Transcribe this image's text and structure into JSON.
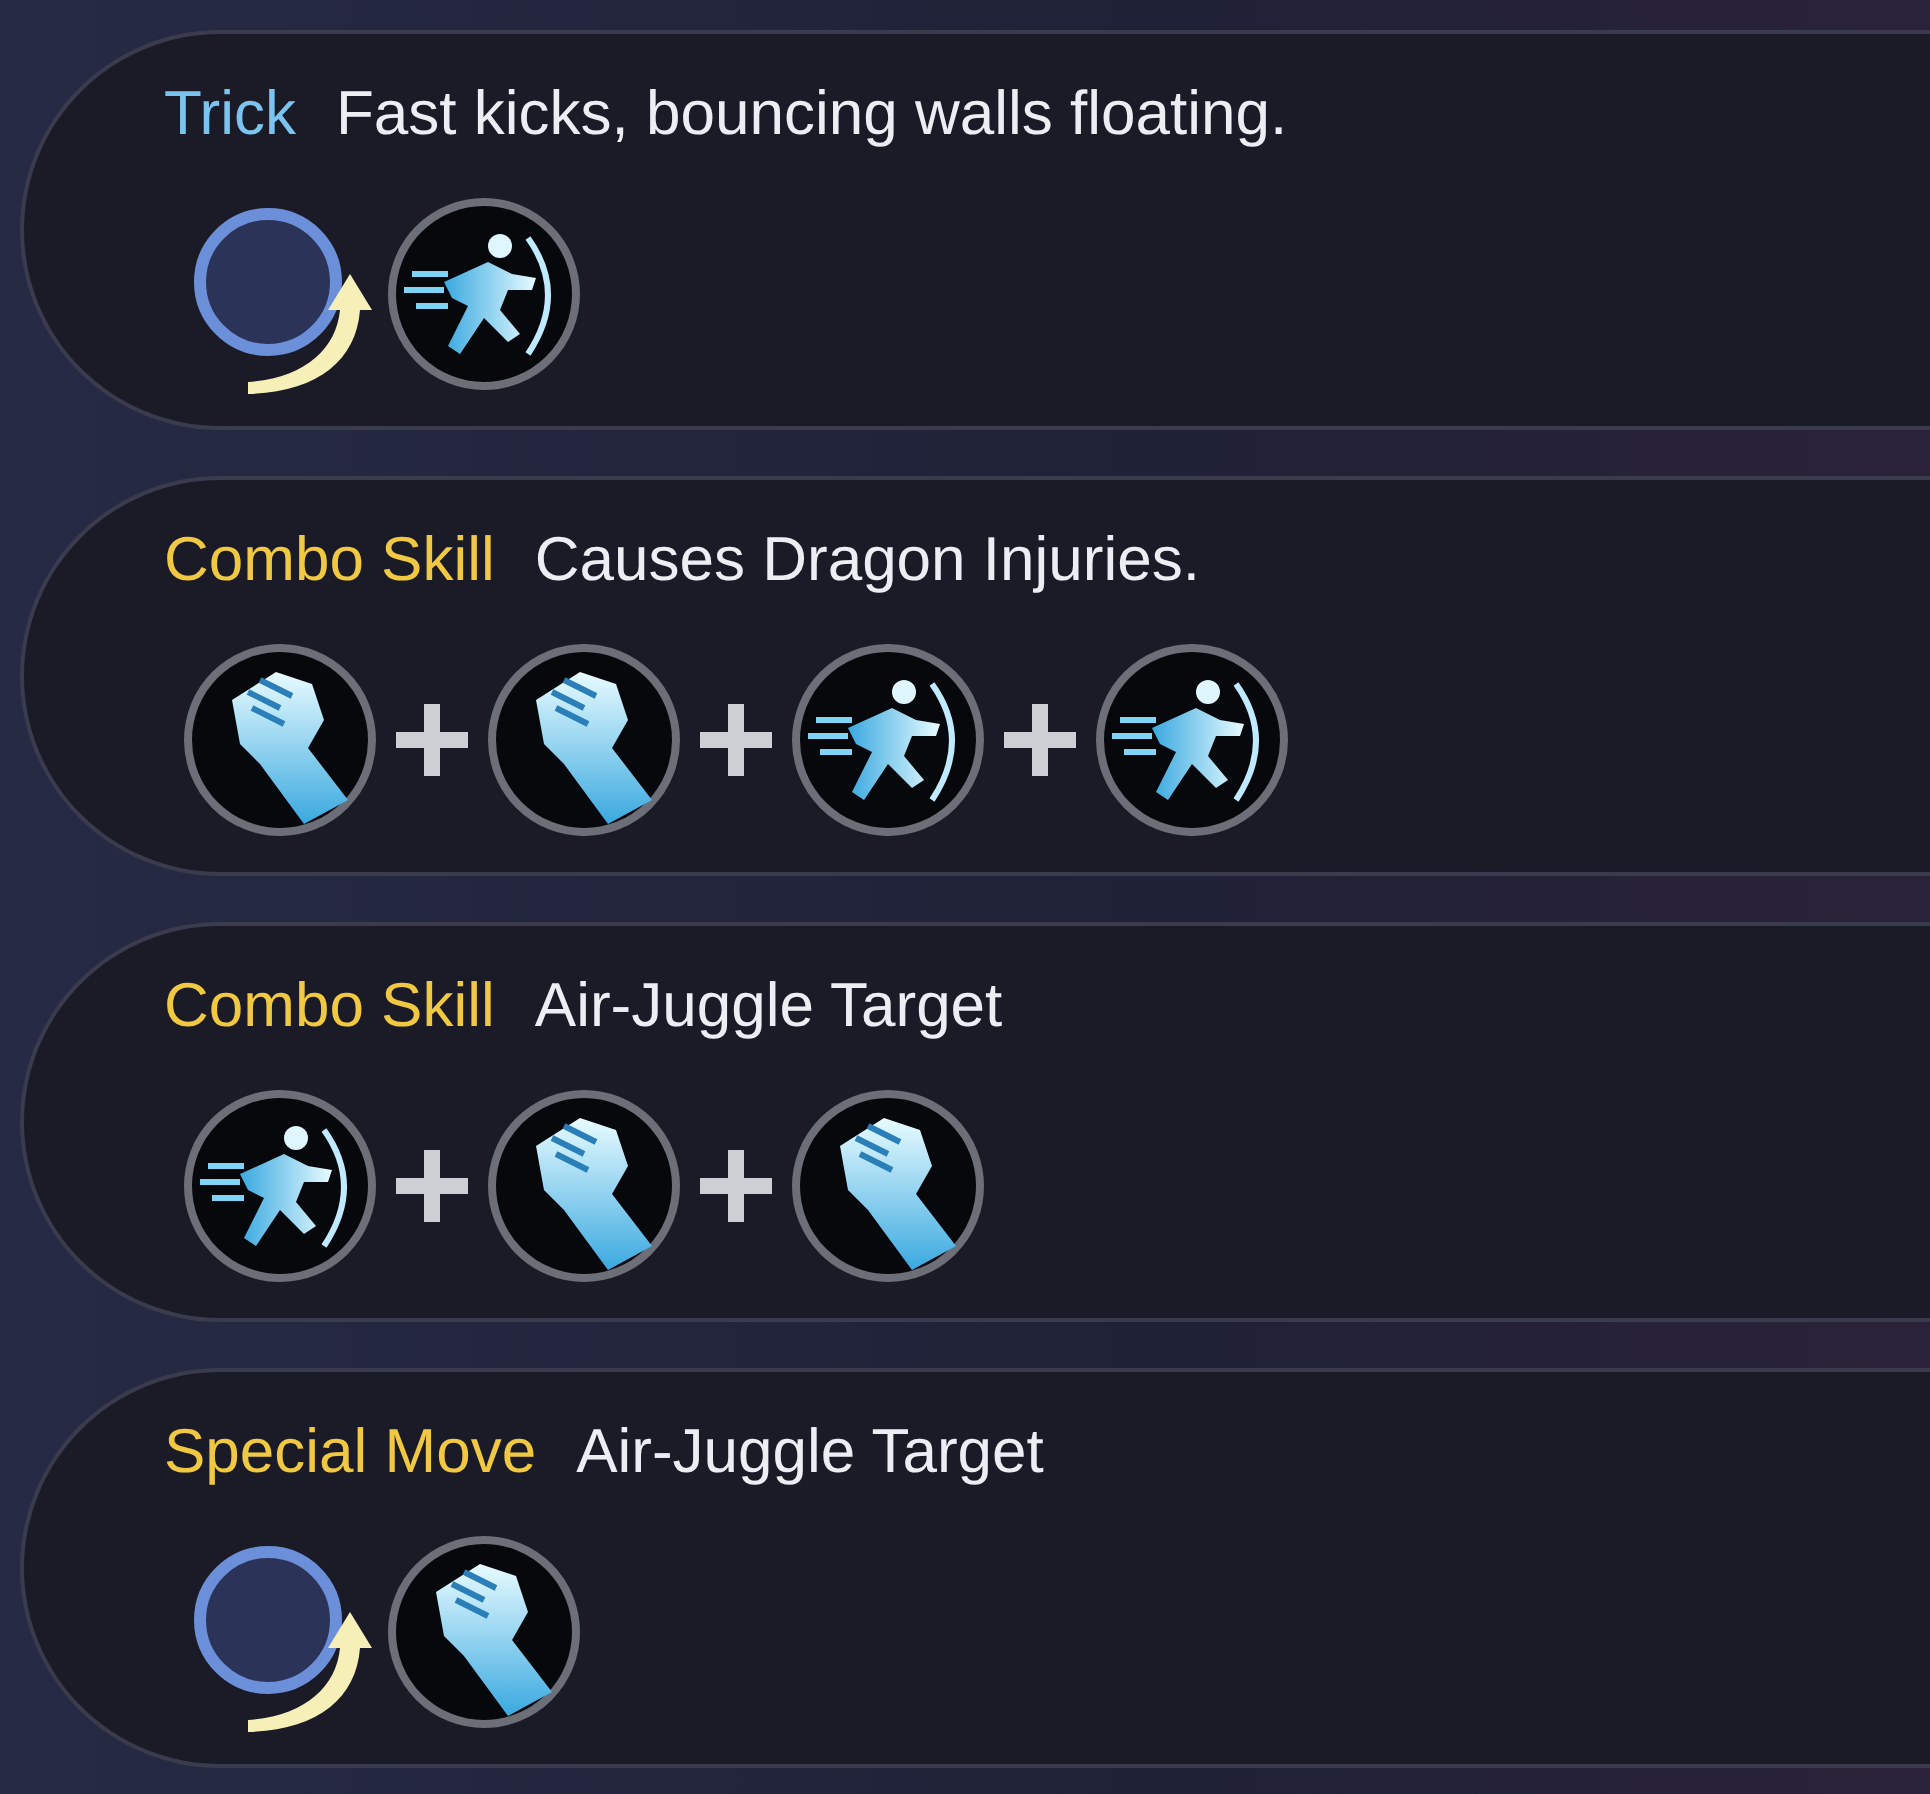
{
  "moves": [
    {
      "label": "Trick",
      "color": "#7cc4f0",
      "description": "Fast kicks, bouncing walls floating.",
      "inputs": [
        {
          "kind": "dodge"
        },
        {
          "kind": "kick"
        }
      ]
    },
    {
      "label": "Combo Skill",
      "color": "#f0c842",
      "description": "Causes Dragon Injuries.",
      "inputs": [
        {
          "kind": "punch"
        },
        {
          "kind": "punch"
        },
        {
          "kind": "kick"
        },
        {
          "kind": "kick"
        }
      ]
    },
    {
      "label": "Combo Skill",
      "color": "#f0c842",
      "description": "Air-Juggle Target",
      "inputs": [
        {
          "kind": "kick"
        },
        {
          "kind": "punch"
        },
        {
          "kind": "punch"
        }
      ]
    },
    {
      "label": "Special Move",
      "color": "#f0c842",
      "description": "Air-Juggle Target",
      "inputs": [
        {
          "kind": "dodge"
        },
        {
          "kind": "punch"
        }
      ]
    }
  ]
}
